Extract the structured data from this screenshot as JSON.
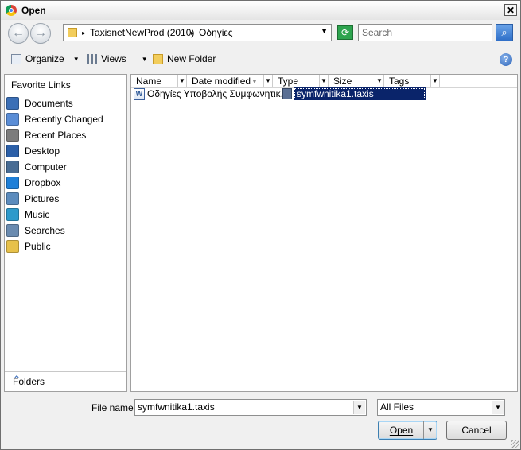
{
  "window": {
    "title": "Open",
    "close_glyph": "✕"
  },
  "nav": {
    "back_glyph": "←",
    "forward_glyph": "→",
    "breadcrumbs": [
      "TaxisnetNewProd (2010)",
      "Οδηγίες"
    ],
    "separator": "▸",
    "dropdown_glyph": "▼",
    "search_placeholder": "Search",
    "refresh_glyph": "⟳",
    "search_glyph": "⌕"
  },
  "toolbar": {
    "organize": "Organize",
    "views": "Views",
    "new_folder": "New Folder",
    "dropdown_glyph": "▼",
    "help_glyph": "?"
  },
  "left_pane": {
    "heading": "Favorite Links",
    "items": [
      {
        "label": "Documents",
        "icon": "documents-icon",
        "color": "#3b6fb6"
      },
      {
        "label": "Recently Changed",
        "icon": "recently-changed-icon",
        "color": "#5a8dd6"
      },
      {
        "label": "Recent Places",
        "icon": "recent-places-icon",
        "color": "#7c7c7c"
      },
      {
        "label": "Desktop",
        "icon": "desktop-icon",
        "color": "#2b5fa8"
      },
      {
        "label": "Computer",
        "icon": "computer-icon",
        "color": "#486c94"
      },
      {
        "label": "Dropbox",
        "icon": "dropbox-icon",
        "color": "#1e7fd8"
      },
      {
        "label": "Pictures",
        "icon": "pictures-icon",
        "color": "#5b8bbd"
      },
      {
        "label": "Music",
        "icon": "music-icon",
        "color": "#2e9acb"
      },
      {
        "label": "Searches",
        "icon": "searches-icon",
        "color": "#6a8bb0"
      },
      {
        "label": "Public",
        "icon": "public-folder-icon",
        "color": "#e7c14a"
      }
    ],
    "folders_label": "Folders",
    "folders_caret": "⌃"
  },
  "file_list": {
    "columns": [
      "Name",
      "Date modified",
      "Type",
      "Size",
      "Tags"
    ],
    "sort_glyph": "▼",
    "files": [
      {
        "name": "Οδηγίες Υποβολής Συμφωνητικ...",
        "icon": "word-document-icon"
      },
      {
        "name": "symfwnitika1.taxis",
        "icon": "taxis-file-icon",
        "selected": true
      }
    ]
  },
  "bottom": {
    "file_name_label": "File name:",
    "file_name_value": "symfwnitika1.taxis",
    "file_type_value": "All Files",
    "open_label": "Open",
    "cancel_label": "Cancel",
    "dropdown_glyph": "▼"
  },
  "colors": {
    "selection": "#0a246a",
    "accent": "#2b63b8"
  }
}
